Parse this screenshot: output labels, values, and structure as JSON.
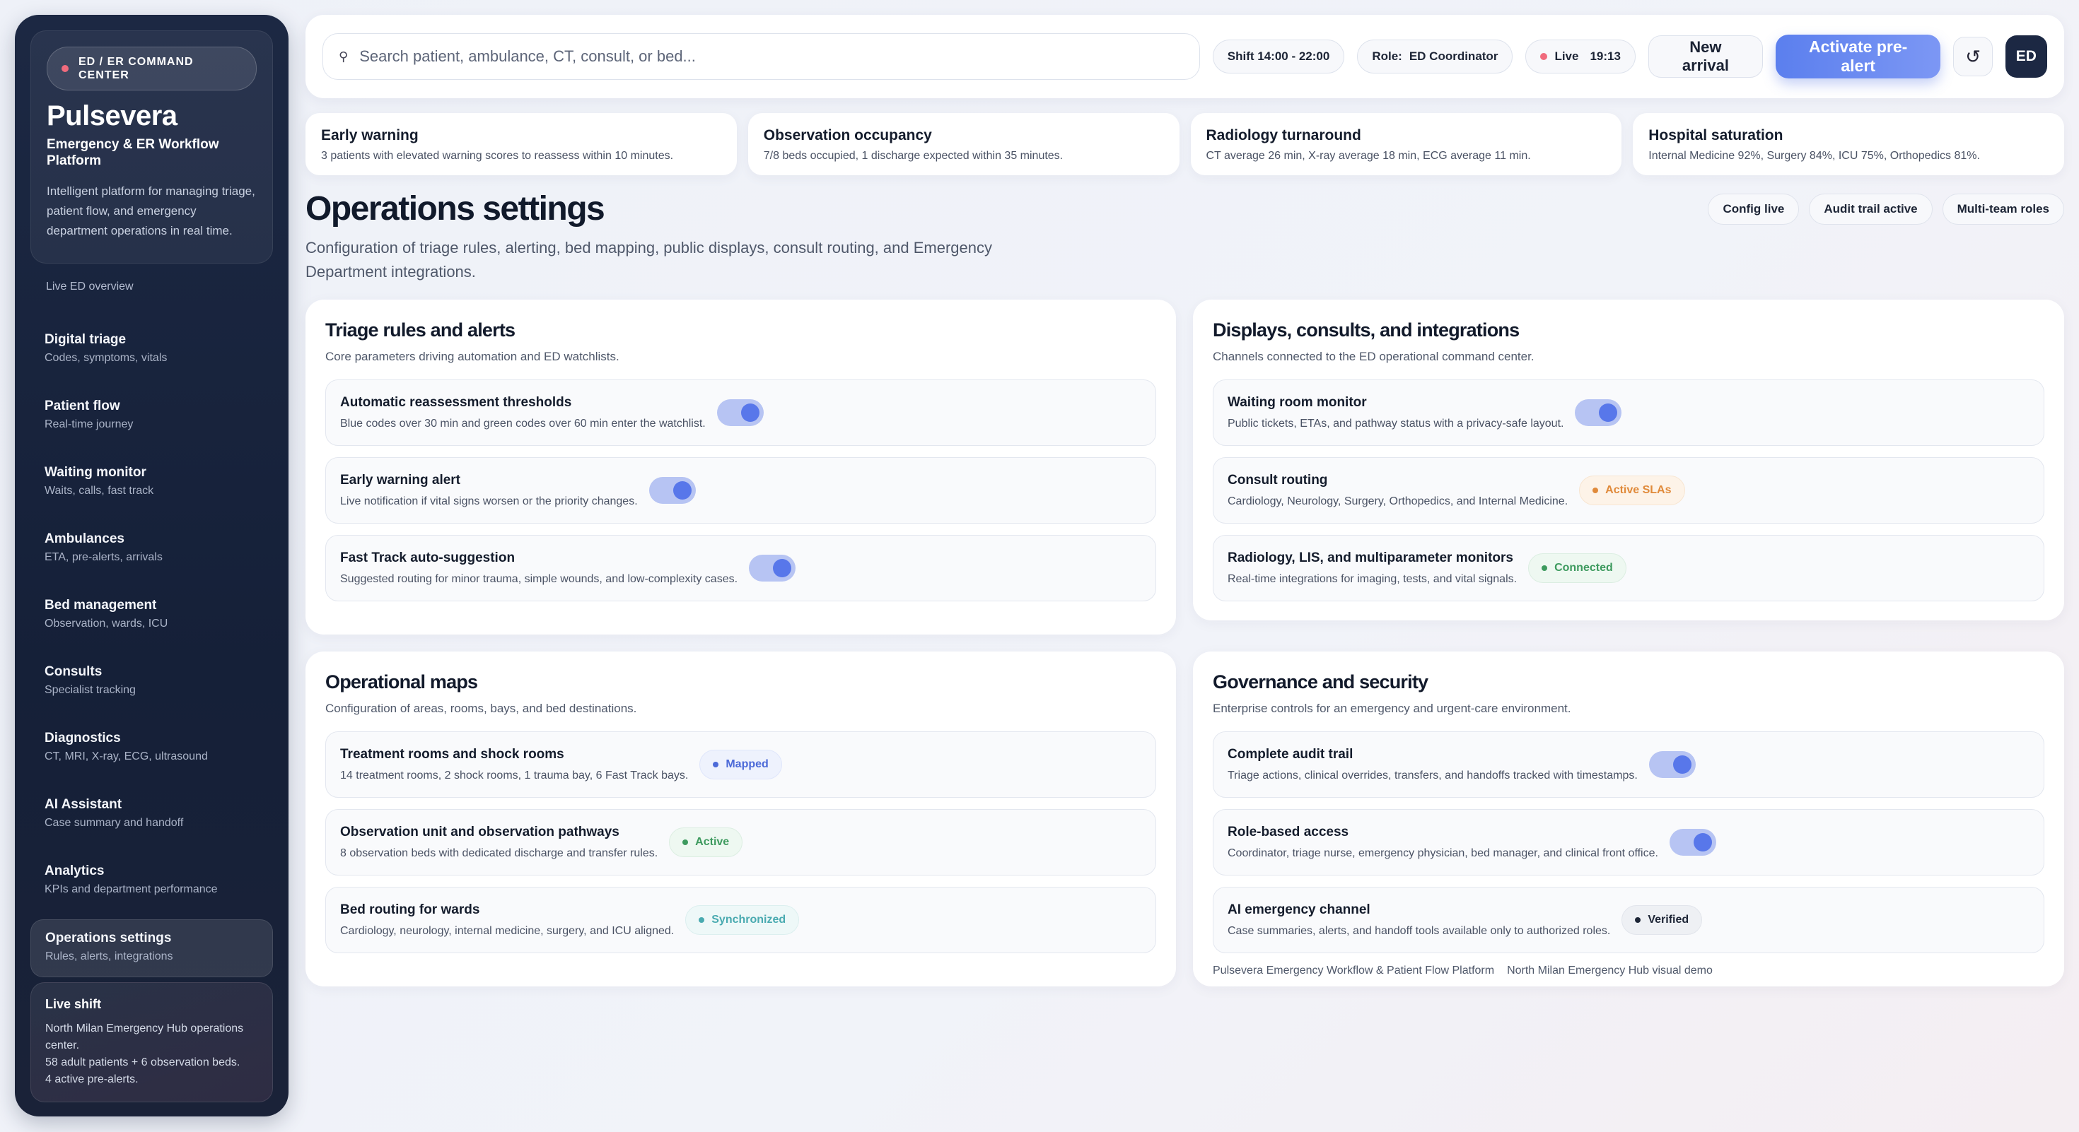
{
  "sidebar": {
    "center_chip": "ED / ER COMMAND CENTER",
    "brand": "Pulsevera",
    "subtitle": "Emergency & ER Workflow Platform",
    "description": "Intelligent platform for managing triage, patient flow, and emergency department operations in real time.",
    "overview_link": "Live ED overview",
    "items": [
      {
        "title": "Digital triage",
        "sub": "Codes, symptoms, vitals"
      },
      {
        "title": "Patient flow",
        "sub": "Real-time journey"
      },
      {
        "title": "Waiting monitor",
        "sub": "Waits, calls, fast track"
      },
      {
        "title": "Ambulances",
        "sub": "ETA, pre-alerts, arrivals"
      },
      {
        "title": "Bed management",
        "sub": "Observation, wards, ICU"
      },
      {
        "title": "Consults",
        "sub": "Specialist tracking"
      },
      {
        "title": "Diagnostics",
        "sub": "CT, MRI, X-ray, ECG, ultrasound"
      },
      {
        "title": "AI Assistant",
        "sub": "Case summary and handoff"
      },
      {
        "title": "Analytics",
        "sub": "KPIs and department performance"
      },
      {
        "title": "Operations settings",
        "sub": "Rules, alerts, integrations"
      }
    ],
    "shift": {
      "title": "Live shift",
      "line1": "North Milan Emergency Hub operations center.",
      "line2": "58 adult patients + 6 observation beds.",
      "line3": "4 active pre-alerts."
    }
  },
  "topbar": {
    "search_placeholder": "Search patient, ambulance, CT, consult, or bed...",
    "shift": "Shift 14:00 - 22:00",
    "role_label": "Role:",
    "role_value": "ED Coordinator",
    "live_label": "Live",
    "live_time": "19:13",
    "new_arrival": "New arrival",
    "activate": "Activate pre-alert",
    "refresh_icon": "refresh-icon",
    "avatar": "ED"
  },
  "kpis": [
    {
      "title": "Early warning",
      "text": "3 patients with elevated warning scores to reassess within 10 minutes."
    },
    {
      "title": "Observation occupancy",
      "text": "7/8 beds occupied, 1 discharge expected within 35 minutes."
    },
    {
      "title": "Radiology turnaround",
      "text": "CT average 26 min, X-ray average 18 min, ECG average 11 min."
    },
    {
      "title": "Hospital saturation",
      "text": "Internal Medicine 92%, Surgery 84%, ICU 75%, Orthopedics 81%."
    }
  ],
  "header": {
    "title": "Operations settings",
    "description": "Configuration of triage rules, alerting, bed mapping, public displays, consult routing, and Emergency Department integrations.",
    "tags": [
      "Config live",
      "Audit trail active",
      "Multi-team roles"
    ]
  },
  "panels": {
    "triage": {
      "title": "Triage rules and alerts",
      "sub": "Core parameters driving automation and ED watchlists.",
      "rows": [
        {
          "title": "Automatic reassessment thresholds",
          "sub": "Blue codes over 30 min and green codes over 60 min enter the watchlist."
        },
        {
          "title": "Early warning alert",
          "sub": "Live notification if vital signs worsen or the priority changes."
        },
        {
          "title": "Fast Track auto-suggestion",
          "sub": "Suggested routing for minor trauma, simple wounds, and low-complexity cases."
        }
      ]
    },
    "displays": {
      "title": "Displays, consults, and integrations",
      "sub": "Channels connected to the ED operational command center.",
      "rows": [
        {
          "title": "Waiting room monitor",
          "sub": "Public tickets, ETAs, and pathway status with a privacy-safe layout."
        },
        {
          "title": "Consult routing",
          "sub": "Cardiology, Neurology, Surgery, Orthopedics, and Internal Medicine.",
          "badge": "Active SLAs"
        },
        {
          "title": "Radiology, LIS, and multiparameter monitors",
          "sub": "Real-time integrations for imaging, tests, and vital signals.",
          "badge": "Connected"
        }
      ]
    },
    "maps": {
      "title": "Operational maps",
      "sub": "Configuration of areas, rooms, bays, and bed destinations.",
      "rows": [
        {
          "title": "Treatment rooms and shock rooms",
          "sub": "14 treatment rooms, 2 shock rooms, 1 trauma bay, 6 Fast Track bays.",
          "badge": "Mapped"
        },
        {
          "title": "Observation unit and observation pathways",
          "sub": "8 observation beds with dedicated discharge and transfer rules.",
          "badge": "Active"
        },
        {
          "title": "Bed routing for wards",
          "sub": "Cardiology, neurology, internal medicine, surgery, and ICU aligned.",
          "badge": "Synchronized"
        }
      ]
    },
    "governance": {
      "title": "Governance and security",
      "sub": "Enterprise controls for an emergency and urgent-care environment.",
      "rows": [
        {
          "title": "Complete audit trail",
          "sub": "Triage actions, clinical overrides, transfers, and handoffs tracked with timestamps."
        },
        {
          "title": "Role-based access",
          "sub": "Coordinator, triage nurse, emergency physician, bed manager, and clinical front office."
        },
        {
          "title": "AI emergency channel",
          "sub": "Case summaries, alerts, and handoff tools available only to authorized roles.",
          "badge": "Verified"
        }
      ],
      "footer1": "Pulsevera Emergency Workflow & Patient Flow Platform",
      "footer2": "North Milan Emergency Hub visual demo"
    }
  }
}
